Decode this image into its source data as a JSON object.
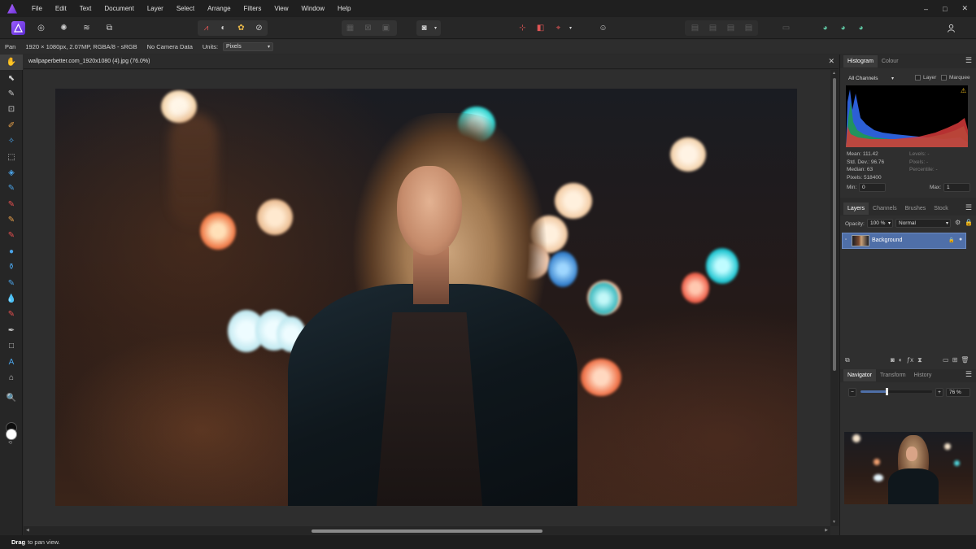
{
  "menubar": {
    "items": [
      "File",
      "Edit",
      "Text",
      "Document",
      "Layer",
      "Select",
      "Arrange",
      "Filters",
      "View",
      "Window",
      "Help"
    ],
    "window_controls": {
      "minimize": "–",
      "maximize": "□",
      "close": "✕"
    }
  },
  "context": {
    "tool": "Pan",
    "doc_info": "1920 × 1080px, 2.07MP, RGBA/8 - sRGB",
    "camera": "No Camera Data",
    "units_label": "Units:",
    "units_value": "Pixels"
  },
  "document": {
    "tab_title": "wallpaperbetter.com_1920x1080 (4).jpg (76.0%)",
    "close_glyph": "✕"
  },
  "histogram_panel": {
    "tabs": [
      "Histogram",
      "Colour"
    ],
    "channels": "All Channels",
    "layer_checkbox": "Layer",
    "marquee_checkbox": "Marquee",
    "stats_left": [
      "Mean: 111.42",
      "Std. Dev.: 96.76",
      "Median: 63",
      "Pixels: 518400"
    ],
    "stats_right": [
      "Levels: -",
      "Pixels: -",
      "Percentile: -"
    ],
    "min_label": "Min:",
    "min_value": "0",
    "max_label": "Max:",
    "max_value": "1"
  },
  "layers_panel": {
    "tabs": [
      "Layers",
      "Channels",
      "Brushes",
      "Stock"
    ],
    "opacity_label": "Opacity:",
    "opacity_value": "100 %",
    "blend_mode": "Normal",
    "layers": [
      {
        "name": "Background"
      }
    ]
  },
  "navigator_panel": {
    "tabs": [
      "Navigator",
      "Transform",
      "History"
    ],
    "zoom_value": "76 %",
    "zoom_fraction": 0.36
  },
  "statusbar": {
    "bold": "Drag",
    "text": "to pan view."
  },
  "colors": {
    "accent": "#4f6fa8",
    "brand": "#7b3fe4"
  }
}
